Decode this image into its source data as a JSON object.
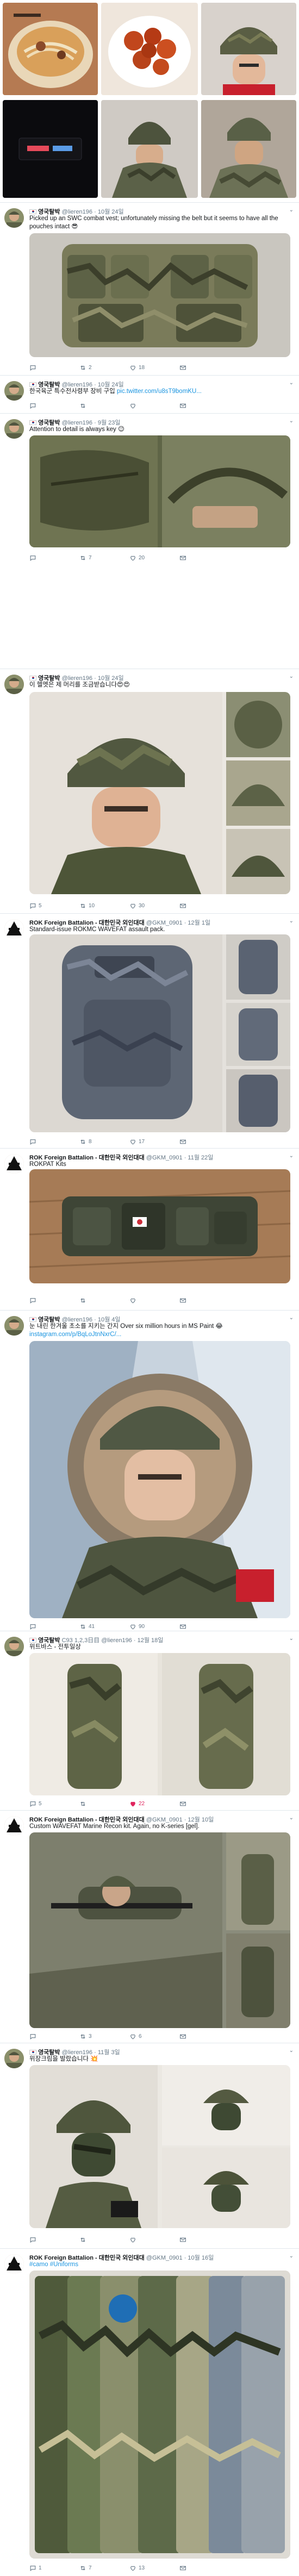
{
  "tweets": [
    {
      "name": "영국탈박",
      "handle": "@lieren196",
      "date": "10월 24일",
      "text": "Picked up an SWC combat vest; unfortunately missing the belt but it seems to have all the pouches intact 😎",
      "link": "",
      "replies": "",
      "retweets": "2",
      "likes": "18"
    },
    {
      "name": "영국탈박",
      "handle": "@lieren196",
      "date": "10월 24일",
      "text": "한국육군 특수전사령부 장비 구입 ",
      "link": "pic.twitter.com/u8sT9bomKU...",
      "replies": "",
      "retweets": "",
      "likes": ""
    },
    {
      "name": "영국탈박",
      "handle": "@lieren196",
      "date": "9월 23일",
      "text": "Attention to detail is always key 😉",
      "link": "",
      "replies": "",
      "retweets": "7",
      "likes": "20"
    },
    {
      "name": "영국탈박",
      "handle": "@lieren196",
      "date": "10월 24일",
      "text": "이 헬멧은 제 머리를 조금받습니다😍😍",
      "link": "",
      "replies": "5",
      "retweets": "10",
      "likes": "30"
    },
    {
      "name": "ROK Foreign Battalion - 대한민국 외인대대",
      "handle": "@GKM_0901",
      "date": "12월 1일",
      "text": "Standard-issue ROKMC WAVEFAT assault pack.",
      "link": "",
      "replies": "",
      "retweets": "8",
      "likes": "17"
    },
    {
      "name": "ROK Foreign Battalion - 대한민국 외인대대",
      "handle": "@GKM_0901",
      "date": "11월 22일",
      "text": "ROKPAT Kits",
      "link": "",
      "replies": "",
      "retweets": "",
      "likes": ""
    },
    {
      "name": "영국탈박",
      "handle": "@lieren196",
      "date": "10월 4일",
      "text": "눈 내린 한겨울 초소를 지키는 간지 Over six million hours in MS Paint 😂",
      "link": "instagram.com/p/BqLoJtnNxrC/...",
      "replies": "",
      "retweets": "41",
      "likes": "90"
    },
    {
      "name": "영국탈박",
      "handle": "@lieren196",
      "date": "12월 18일",
      "badge": "C93 1,2,3日目",
      "text": "위트바스 - 전투일상",
      "link": "",
      "replies": "5",
      "retweets": "",
      "likes": "22"
    },
    {
      "name": "ROK Foreign Battalion - 대한민국 외인대대",
      "handle": "@GKM_0901",
      "date": "12월 10일",
      "text": "Custom WAVEFAT Marine Recon kit. Again, no K-series [gel].",
      "link": "",
      "replies": "",
      "retweets": "3",
      "likes": "6"
    },
    {
      "name": "영국탈박",
      "handle": "@lieren196",
      "date": "11월 3일",
      "text": "위장크림을 발랐습니다 💥",
      "link": "",
      "replies": "",
      "retweets": "",
      "likes": ""
    },
    {
      "name": "ROK Foreign Battalion - 대한민국 외인대대",
      "handle": "@GKM_0901",
      "date": "10월 16일",
      "text": "#camo #Uniforms",
      "link": "",
      "replies": "1",
      "retweets": "7",
      "likes": "13"
    }
  ],
  "colors": {
    "link": "#1b95e0",
    "like": "#e0245e",
    "muted": "#657786"
  },
  "icons": [
    "reply-icon",
    "retweet-icon",
    "like-icon",
    "mail-icon",
    "more-icon"
  ]
}
